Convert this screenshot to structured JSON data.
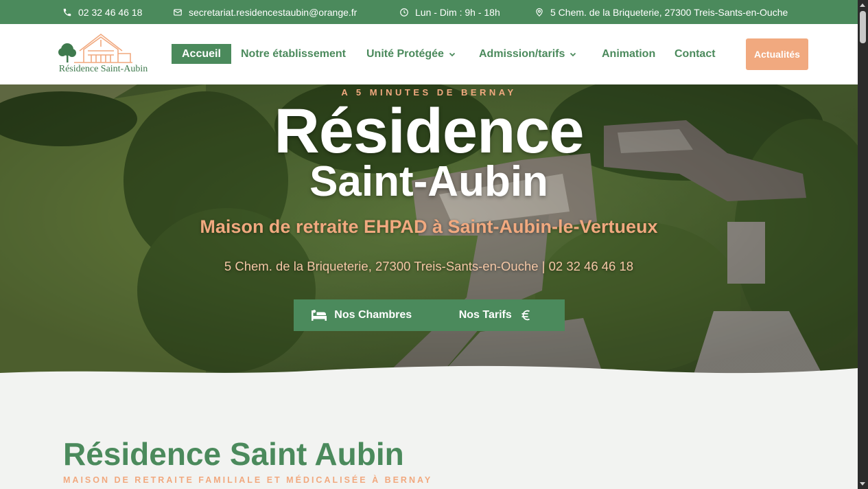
{
  "topbar": {
    "phone": "02 32 46 46 18",
    "email": "secretariat.residencestaubin@orange.fr",
    "hours": "Lun - Dim : 9h - 18h",
    "address": "5 Chem. de la Briqueterie, 27300 Treis-Sants-en-Ouche"
  },
  "logo": {
    "text": "Résidence Saint-Aubin"
  },
  "nav": {
    "items": [
      {
        "label": "Accueil"
      },
      {
        "label": "Notre établissement"
      },
      {
        "label": "Unité Protégée"
      },
      {
        "label": "Admission/tarifs"
      },
      {
        "label": "Animation"
      },
      {
        "label": "Contact"
      }
    ],
    "cta": "Actualités"
  },
  "hero": {
    "kicker": "A 5 MINUTES DE BERNAY",
    "title_line1": "Résidence",
    "title_line2": "Saint-Aubin",
    "subtitle": "Maison de retraite EHPAD à Saint-Aubin-le-Vertueux",
    "address_line": "5 Chem. de la Briqueterie, 27300 Treis-Sants-en-Ouche  |  02 32 46 46 18",
    "btn_rooms": "Nos Chambres",
    "btn_prices": "Nos Tarifs"
  },
  "section": {
    "title": "Résidence Saint Aubin",
    "subtitle": "MAISON DE RETRAITE FAMILIALE ET MÉDICALISÉE À BERNAY"
  },
  "colors": {
    "brand_green": "#4b8a5c",
    "accent_peach": "#f1a97f",
    "page_bg": "#f2f3f1"
  }
}
